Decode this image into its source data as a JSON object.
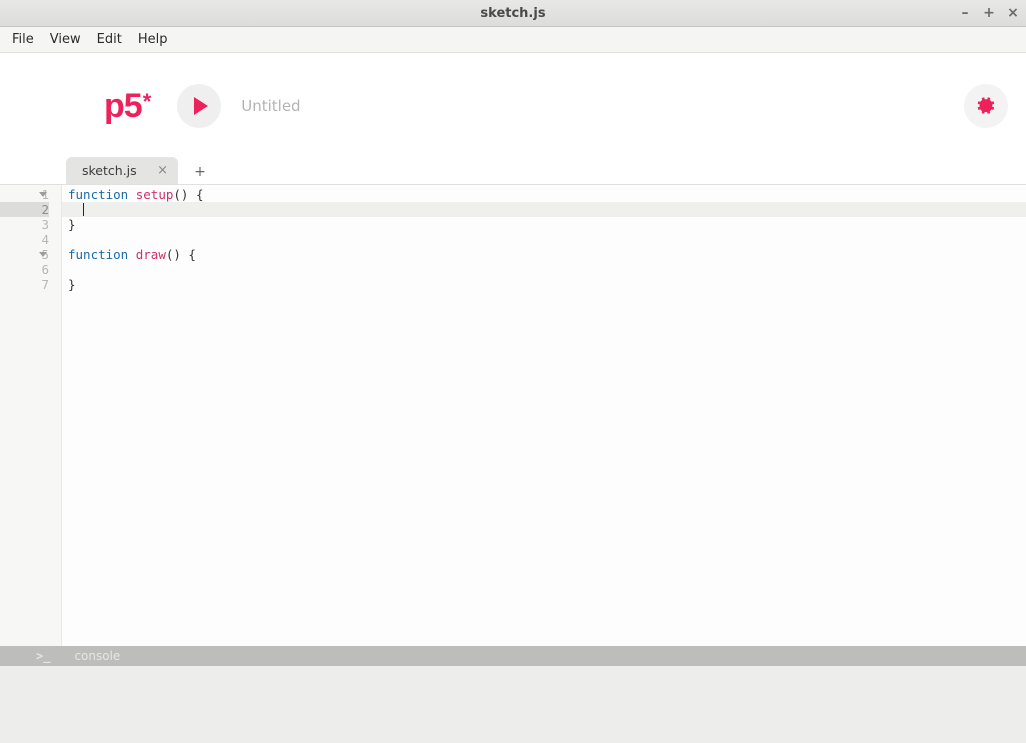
{
  "window": {
    "title": "sketch.js"
  },
  "menubar": {
    "file": "File",
    "view": "View",
    "edit": "Edit",
    "help": "Help"
  },
  "toolbar": {
    "logo_text": "p5",
    "logo_star": "*",
    "sketch_name": "Untitled"
  },
  "tabs": {
    "items": [
      {
        "label": "sketch.js"
      }
    ],
    "add": "+"
  },
  "editor": {
    "lines": [
      {
        "num": "1",
        "kw": "function",
        "fn": "setup",
        "rest": "() {",
        "fold": true,
        "current": false
      },
      {
        "num": "2",
        "indent": "  ",
        "fold": false,
        "current": true
      },
      {
        "num": "3",
        "indent": "",
        "rest": "}",
        "fold": false,
        "current": false
      },
      {
        "num": "4",
        "indent": "",
        "fold": false,
        "current": false
      },
      {
        "num": "5",
        "kw": "function",
        "fn": "draw",
        "rest": "() {",
        "fold": true,
        "current": false
      },
      {
        "num": "6",
        "indent": "",
        "fold": false,
        "current": false
      },
      {
        "num": "7",
        "indent": "",
        "rest": "}",
        "fold": false,
        "current": false
      }
    ]
  },
  "console": {
    "prompt": ">_",
    "label": "console"
  },
  "colors": {
    "accent": "#ed225d"
  }
}
